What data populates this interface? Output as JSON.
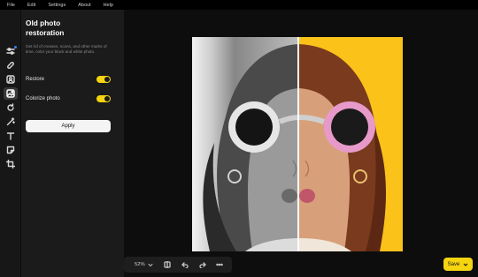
{
  "menu": [
    "File",
    "Edit",
    "Settings",
    "About",
    "Help"
  ],
  "tools": [
    {
      "name": "adjust-icon"
    },
    {
      "name": "bandage-icon"
    },
    {
      "name": "portrait-icon"
    },
    {
      "name": "photo-restoration-icon"
    },
    {
      "name": "rotate-icon"
    },
    {
      "name": "magic-wand-icon"
    },
    {
      "name": "text-icon"
    },
    {
      "name": "sticker-icon"
    },
    {
      "name": "crop-icon"
    }
  ],
  "panel": {
    "title": "Old photo restoration",
    "description": "Get rid of creases, scans, and other marks of time, color your black and white photo.",
    "toggles": [
      {
        "label": "Restore",
        "on": true
      },
      {
        "label": "Colorize photo",
        "on": true
      }
    ],
    "apply_label": "Apply"
  },
  "bottombar": {
    "zoom": "52%"
  },
  "save_label": "Save",
  "colors": {
    "accent": "#f5d410",
    "panel": "#1b1b1b",
    "rail": "#171717",
    "canvas": "#0d0d0d",
    "photo_background": "#fbc21a"
  }
}
